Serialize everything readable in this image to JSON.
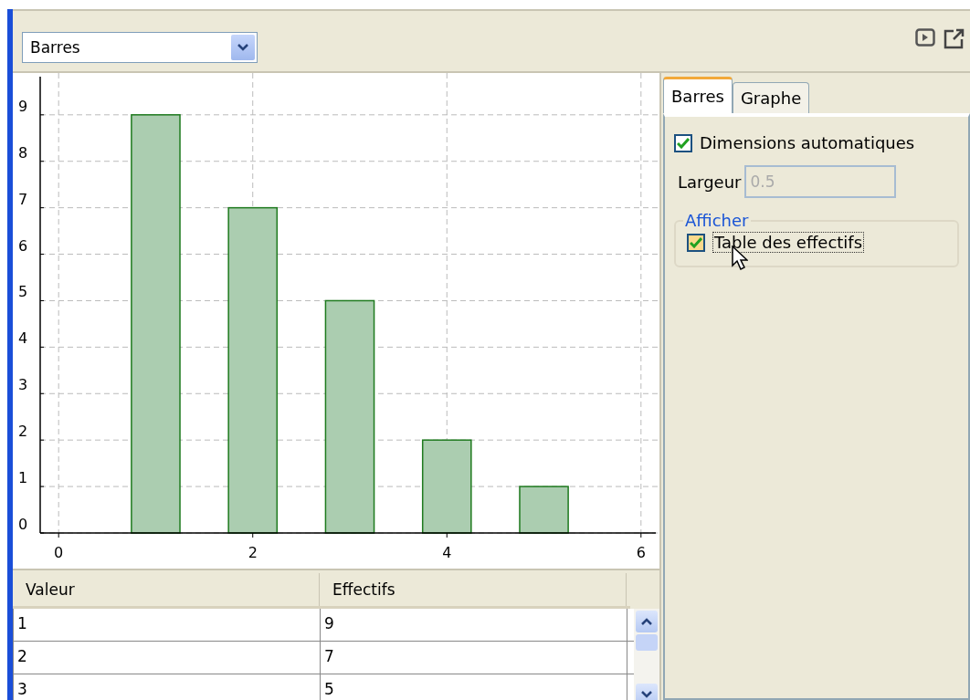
{
  "toolbar": {
    "chart_type": "Barres"
  },
  "chart": {
    "chart_data": {
      "type": "bar",
      "x": [
        1,
        2,
        3,
        4,
        5
      ],
      "values": [
        9,
        7,
        5,
        2,
        1
      ],
      "xlim": [
        -0.19,
        6.19
      ],
      "grid": true,
      "ylim": [
        0,
        9.9
      ],
      "xticks": [
        0,
        2,
        4,
        6
      ],
      "yticks": [
        0,
        1,
        2,
        3,
        4,
        5,
        6,
        7,
        8,
        9
      ]
    }
  },
  "table": {
    "columns": [
      "Valeur",
      "Effectifs"
    ],
    "rows": [
      [
        "1",
        "9"
      ],
      [
        "2",
        "7"
      ],
      [
        "3",
        "5"
      ]
    ]
  },
  "settings": {
    "tabs": [
      {
        "label": "Barres",
        "selected": true
      },
      {
        "label": "Graphe",
        "selected": false
      }
    ],
    "auto_dimensions": {
      "label": "Dimensions automatiques",
      "checked": true
    },
    "width": {
      "label": "Largeur",
      "value": "0.5",
      "disabled": true
    },
    "display_group": {
      "title": "Afficher",
      "frequency_table": {
        "label": "Table des effectifs",
        "checked": true
      }
    }
  }
}
